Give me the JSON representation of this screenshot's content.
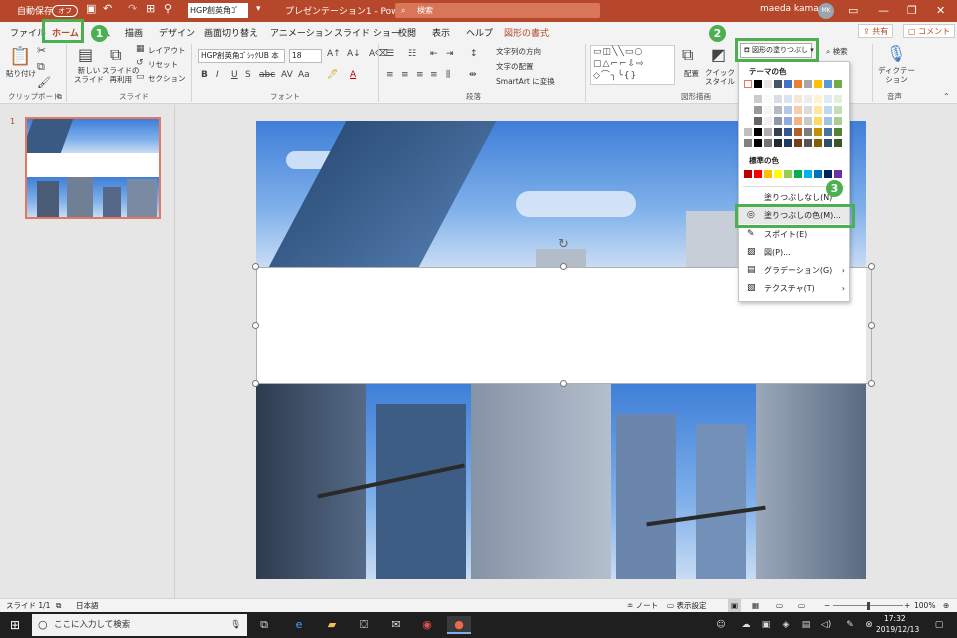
{
  "titlebar": {
    "autosave_label": "自動保存",
    "autosave_state": "オフ",
    "font_name": "HGP創英角ｺﾞ",
    "doc_title": "プレゼンテーション1 - PowerPo...",
    "search_placeholder": "検索",
    "user_name": "maeda kamari",
    "avatar_initials": "MK",
    "minimize": "—",
    "restore": "❐",
    "close": "✕"
  },
  "tabs": [
    {
      "label": "ファイル"
    },
    {
      "label": "ホーム"
    },
    {
      "label": "挿入"
    },
    {
      "label": "描画"
    },
    {
      "label": "デザイン"
    },
    {
      "label": "画面切り替え"
    },
    {
      "label": "アニメーション"
    },
    {
      "label": "スライド ショー"
    },
    {
      "label": "校閲"
    },
    {
      "label": "表示"
    },
    {
      "label": "ヘルプ"
    },
    {
      "label": "図形の書式"
    }
  ],
  "share_button": "共有",
  "comment_button": "コメント",
  "ribbon": {
    "paste": "貼り付け",
    "clipboard_group": "クリップボード",
    "new_slide": "新しい\nスライド",
    "reuse_slide": "スライドの\n再利用",
    "layout": "レイアウト",
    "reset": "リセット",
    "section": "セクション",
    "slides_group": "スライド",
    "font_value": "HGP創英角ｺﾞｼｯｸUB 本",
    "font_size": "18",
    "font_group": "フォント",
    "text_direction": "文字列の方向",
    "align_text": "文字の配置",
    "smartart": "SmartArt に変換",
    "paragraph_group": "段落",
    "arrange": "配置",
    "quick_style": "クイック\nスタイル",
    "drawing_group": "図形描画",
    "shape_fill": "図形の塗りつぶし",
    "find": "検索",
    "dictation": "ディクテー\nション",
    "voice_group": "音声"
  },
  "fill_menu": {
    "theme_colors_label": "テーマの色",
    "standard_colors_label": "標準の色",
    "no_fill": "塗りつぶしなし(N)",
    "more_colors": "塗りつぶしの色(M)...",
    "eyedropper": "スポイト(E)",
    "picture": "図(P)...",
    "gradient": "グラデーション(G)",
    "texture": "テクスチャ(T)",
    "theme_colors": [
      "#ffffff",
      "#000000",
      "#e7e6e6",
      "#44546a",
      "#4472c4",
      "#ed7d31",
      "#a5a5a5",
      "#ffc000",
      "#5b9bd5",
      "#70ad47"
    ],
    "standard_colors": [
      "#c00000",
      "#ff0000",
      "#ffc000",
      "#ffff00",
      "#92d050",
      "#00b050",
      "#00b0f0",
      "#0070c0",
      "#002060",
      "#7030a0"
    ]
  },
  "callouts": [
    "1",
    "2",
    "3"
  ],
  "slide_number": "1",
  "status": {
    "slide_info": "スライド 1/1",
    "language": "日本語",
    "notes": "ノート",
    "display_settings": "表示設定",
    "zoom": "100%"
  },
  "taskbar": {
    "search_placeholder": "ここに入力して検索",
    "time": "17:32",
    "date": "2019/12/13"
  },
  "colors": {
    "accent": "#b7472a",
    "highlight": "#4caf50"
  }
}
